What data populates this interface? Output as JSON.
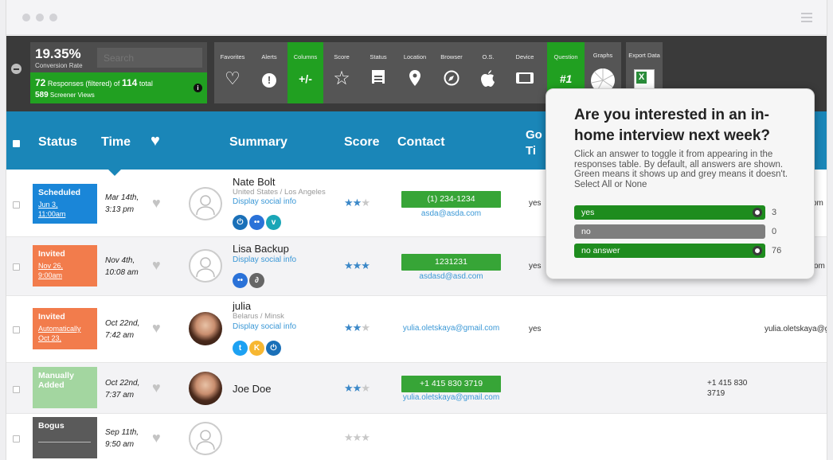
{
  "toolbar": {
    "conversion_rate_value": "19.35%",
    "conversion_rate_label": "Conversion Rate",
    "search_placeholder": "Search",
    "responses_count": "72",
    "responses_text_a": "Responses (filtered) of",
    "responses_total": "114",
    "responses_text_b": "total",
    "views_count": "589",
    "views_label": "Screener Views",
    "tools": [
      {
        "label": "Favorites",
        "icon": "heart-outline-icon",
        "glyph": "♡"
      },
      {
        "label": "Alerts",
        "icon": "alert-icon",
        "glyph": "!"
      },
      {
        "label": "Columns",
        "icon": "columns-toggle-icon",
        "glyph": "+/-"
      },
      {
        "label": "Score",
        "icon": "star-outline-icon",
        "glyph": "☆"
      },
      {
        "label": "Status",
        "icon": "calendar-icon",
        "glyph": "▤"
      },
      {
        "label": "Location",
        "icon": "map-pin-icon",
        "glyph": "⚲"
      },
      {
        "label": "Browser",
        "icon": "compass-icon",
        "glyph": "⊘"
      },
      {
        "label": "O.S.",
        "icon": "apple-icon",
        "glyph": ""
      },
      {
        "label": "Device",
        "icon": "tablet-icon",
        "glyph": "▭"
      },
      {
        "label": "Question",
        "icon": "question-number-icon",
        "glyph": "#1"
      }
    ],
    "graphs_label": "Graphs",
    "export_label": "Export Data"
  },
  "table": {
    "headers": {
      "status": "Status",
      "time": "Time",
      "summary": "Summary",
      "score": "Score",
      "contact": "Contact",
      "go_tim": "Go\nTi"
    },
    "rows": [
      {
        "status": "Scheduled",
        "status_sub": "Jun 3,\n11:00am",
        "time": "Mar 14th,\n3:13 pm",
        "name": "Nate Bolt",
        "location": "United States / Los Angeles",
        "social_link": "Display social info",
        "score": 2,
        "phone": "(1) 234-1234",
        "email": "asda@asda.com",
        "answer": "yes",
        "right": "com"
      },
      {
        "status": "Invited",
        "status_sub": "Nov 26,\n9:00am",
        "time": "Nov 4th,\n10:08 am",
        "name": "Lisa Backup",
        "social_link": "Display social info",
        "score": 3,
        "phone": "1231231",
        "email": "asdasd@asd.com",
        "answer": "yes",
        "right": "l.com"
      },
      {
        "status": "Invited",
        "status_sub": "Automatically\nOct 23,",
        "time": "Oct 22nd,\n7:42 am",
        "name": "julia",
        "location": "Belarus / Minsk",
        "social_link": "Display social info",
        "score": 2,
        "email": "yulia.oletskaya@gmail.com",
        "answer": "yes",
        "right": "yulia.oletskaya@gr"
      },
      {
        "status": "Manually\nAdded",
        "time": "Oct 22nd,\n7:37 am",
        "name": "Joe Doe",
        "score": 2,
        "phone": "+1 415 830 3719",
        "email": "yulia.oletskaya@gmail.com",
        "right": "+1 415 830\n3719"
      },
      {
        "status": "Bogus",
        "time": "Sep 11th,\n9:50 am",
        "score": 0
      }
    ]
  },
  "popover": {
    "title": "Are you interested in an in-home interview next week?",
    "description_a": "Click an answer to toggle it from appearing in the responses table. By default, all answers are shown. Green means it shows up and grey means it doesn't. Select",
    "all_link": "All",
    "or_word": "or",
    "none_link": "None",
    "answers": [
      {
        "label": "yes",
        "count": "3",
        "enabled": true
      },
      {
        "label": "no",
        "count": "0",
        "enabled": false
      },
      {
        "label": "no answer",
        "count": "76",
        "enabled": true
      }
    ]
  },
  "colors": {
    "header_blue": "#1a86b8",
    "active_green": "#21a021",
    "scheduled": "#1a86d8",
    "invited": "#f27c4c",
    "manual": "#a3d6a0",
    "bogus": "#5a5a5a"
  }
}
